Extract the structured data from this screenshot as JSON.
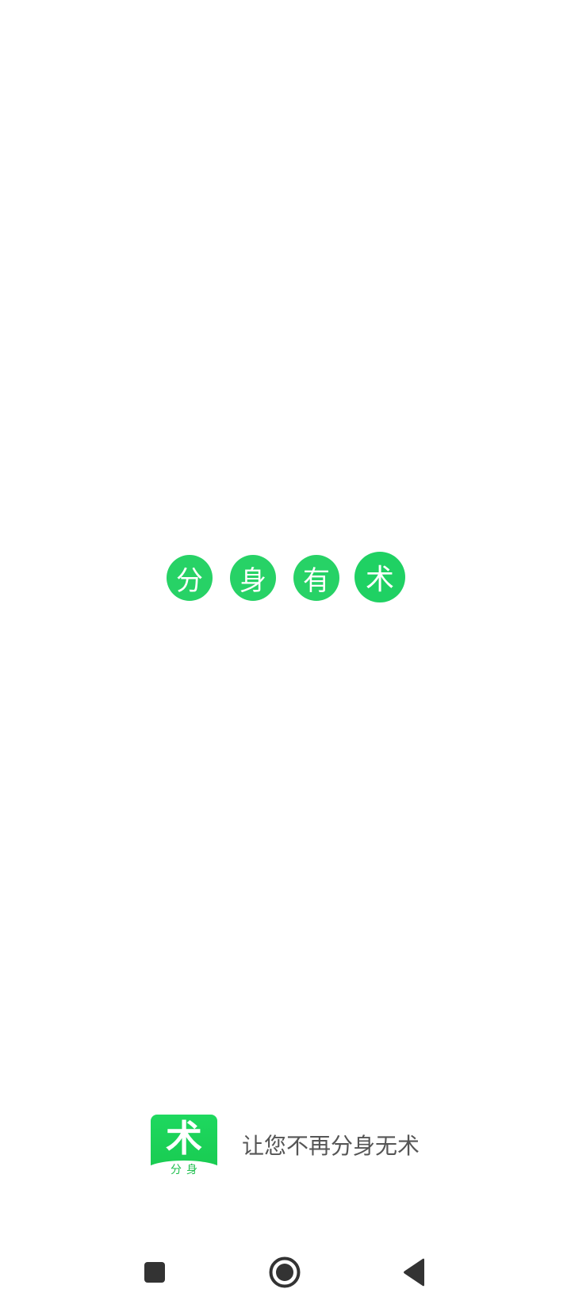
{
  "splash": {
    "chars": [
      "分",
      "身",
      "有",
      "术"
    ]
  },
  "brand": {
    "logo_main": "术",
    "logo_sub": "分身",
    "slogan": "让您不再分身无术"
  },
  "colors": {
    "accent": "#27d266",
    "accent_alt": "#1fd163",
    "slogan_text": "#555555",
    "nav_icon": "#333333"
  },
  "navbar": {
    "recent_icon": "square-icon",
    "home_icon": "circle-home-icon",
    "back_icon": "triangle-back-icon"
  }
}
